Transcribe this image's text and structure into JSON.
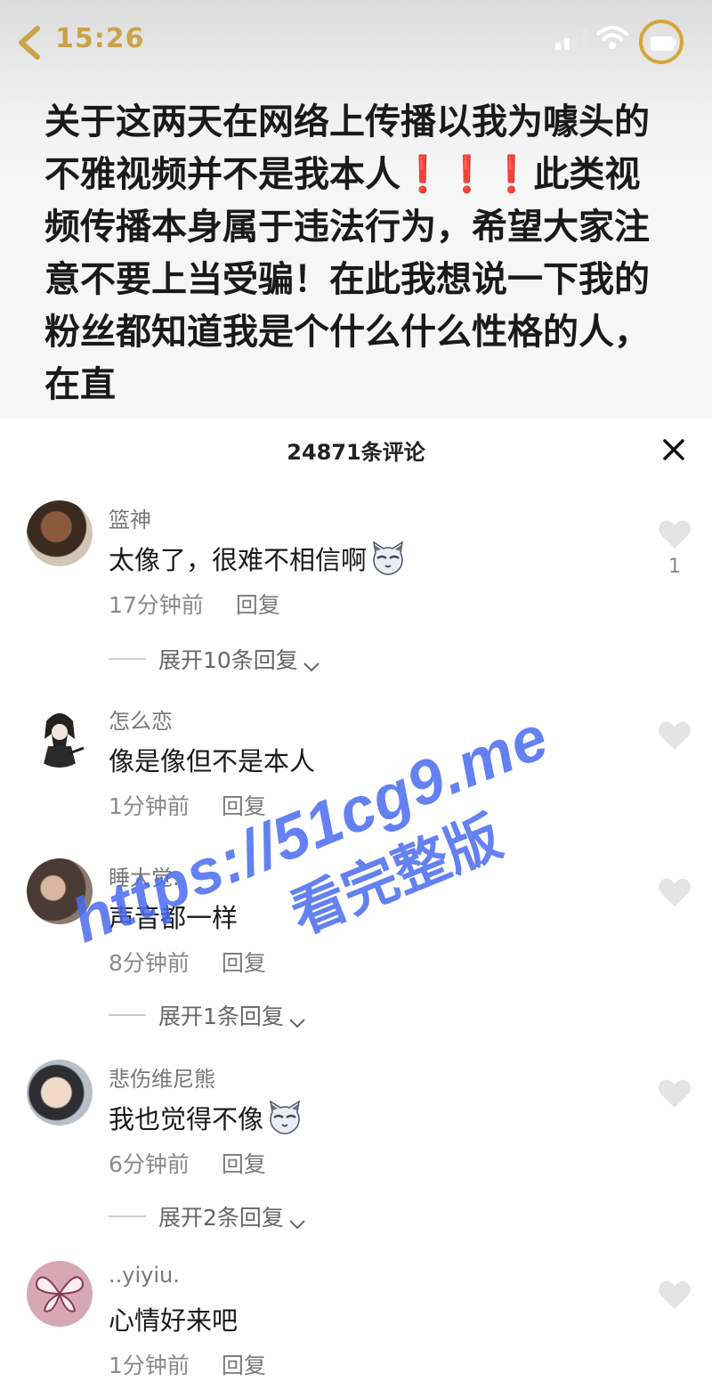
{
  "status_bar": {
    "time": "15:26"
  },
  "post": {
    "line1": "关于这两天在网络上传播以我为噱头的不雅视频并不是我本人",
    "exclaims": "❗❗❗",
    "line2": "此类视频传播本身属于违法行为，希望大家注意不要上当受骗！在此我想说一下我的粉丝都知道我是个什么什么性格的人，在直"
  },
  "comments_sheet": {
    "title": "24871条评论",
    "comments": [
      {
        "username": "篮神",
        "text": "太像了，很难不相信啊",
        "time": "17分钟前",
        "reply_label": "回复",
        "likes": "1",
        "expand_label": "展开10条回复"
      },
      {
        "username": "怎么恋",
        "text": "像是像但不是本人",
        "time": "1分钟前",
        "reply_label": "回复"
      },
      {
        "username": "睡大觉.",
        "text": "声音都一样",
        "time": "8分钟前",
        "reply_label": "回复",
        "expand_label": "展开1条回复"
      },
      {
        "username": "悲伤维尼熊",
        "text": "我也觉得不像",
        "time": "6分钟前",
        "reply_label": "回复",
        "expand_label": "展开2条回复"
      },
      {
        "username": "..yiyiu.",
        "text": "心情好来吧",
        "time": "1分钟前",
        "reply_label": "回复"
      }
    ]
  },
  "watermark": {
    "url": "https://51cg9.me",
    "text": "看完整版"
  },
  "colors": {
    "accent_gold": "#c8a34a",
    "watermark_blue": "#4a6cf0",
    "exclaim_red": "#e02020"
  }
}
